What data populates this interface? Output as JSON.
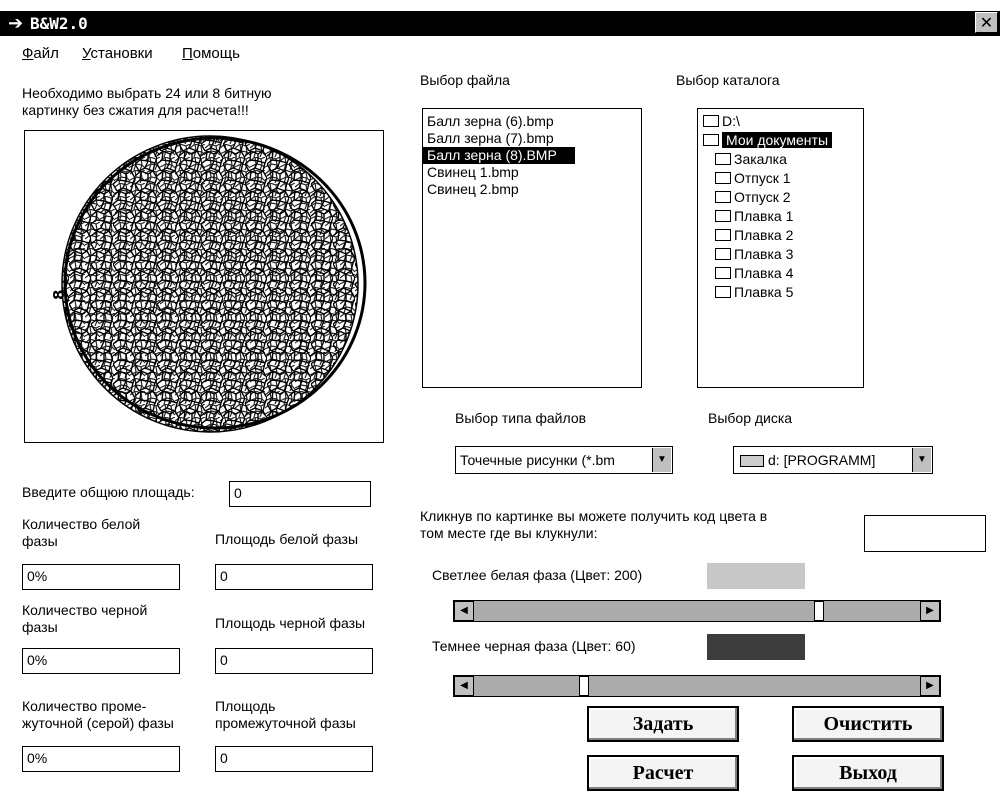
{
  "window": {
    "title": "B&W2.0",
    "close_glyph": "✕"
  },
  "menu": [
    {
      "mnemonic": "Ф",
      "rest": "айл"
    },
    {
      "mnemonic": "У",
      "rest": "становки"
    },
    {
      "mnemonic": "П",
      "rest": "омощь"
    }
  ],
  "hint": {
    "line1": "Необходимо выбрать 24 или 8 битную",
    "line2": "картинку без сжатия для расчета!!!"
  },
  "image_panel": {
    "side_label": "8",
    "description": "grain structure micrograph"
  },
  "file_picker": {
    "label": "Выбор файла",
    "items": [
      "Балл зерна (6).bmp",
      "Балл зерна (7).bmp",
      "Балл зерна (8).BMP",
      "Свинец 1.bmp",
      "Свинец 2.bmp"
    ],
    "selected_index": 2
  },
  "dir_picker": {
    "label": "Выбор каталога",
    "root": "D:\\",
    "current": "Мои документы",
    "folders": [
      "Закалка",
      "Отпуск 1",
      "Отпуск 2",
      "Плавка 1",
      "Плавка 2",
      "Плавка 3",
      "Плавка 4",
      "Плавка 5"
    ]
  },
  "file_type": {
    "label": "Выбор типа файлов",
    "value": "Точечные рисунки (*.bm"
  },
  "drive": {
    "label": "Выбор диска",
    "value": "d: [PROGRAMM]"
  },
  "area": {
    "label": "Введите общюю площадь:",
    "value": "0"
  },
  "white": {
    "count_label_1": "Количество белой",
    "count_label_2": "фазы",
    "count_value": "0%",
    "area_label": "Площодь белой фазы",
    "area_value": "0"
  },
  "black": {
    "count_label_1": "Количество черной",
    "count_label_2": "фазы",
    "count_value": "0%",
    "area_label": "Площодь черной фазы",
    "area_value": "0"
  },
  "gray": {
    "count_label_1": "Количество проме-",
    "count_label_2": "жуточной (серой) фазы",
    "count_value": "0%",
    "area_label_1": "Площодь",
    "area_label_2": "промежуточной фазы",
    "area_value": "0"
  },
  "color_probe": {
    "line1": "Кликнув по картинке вы можете получить  код цвета в",
    "line2": "том месте где вы клукнули:",
    "value": ""
  },
  "lighter": {
    "label": "Светлее белая фаза (Цвет:  200)",
    "color_value": 200,
    "swatch_color": "#c8c8c8",
    "slider_fraction": 0.78
  },
  "darker": {
    "label": "Темнее черная фаза (Цвет:  60)",
    "color_value": 60,
    "swatch_color": "#3c3c3c",
    "slider_fraction": 0.24
  },
  "buttons": {
    "set": "Задать",
    "clear": "Очистить",
    "calc": "Расчет",
    "exit": "Выход"
  }
}
